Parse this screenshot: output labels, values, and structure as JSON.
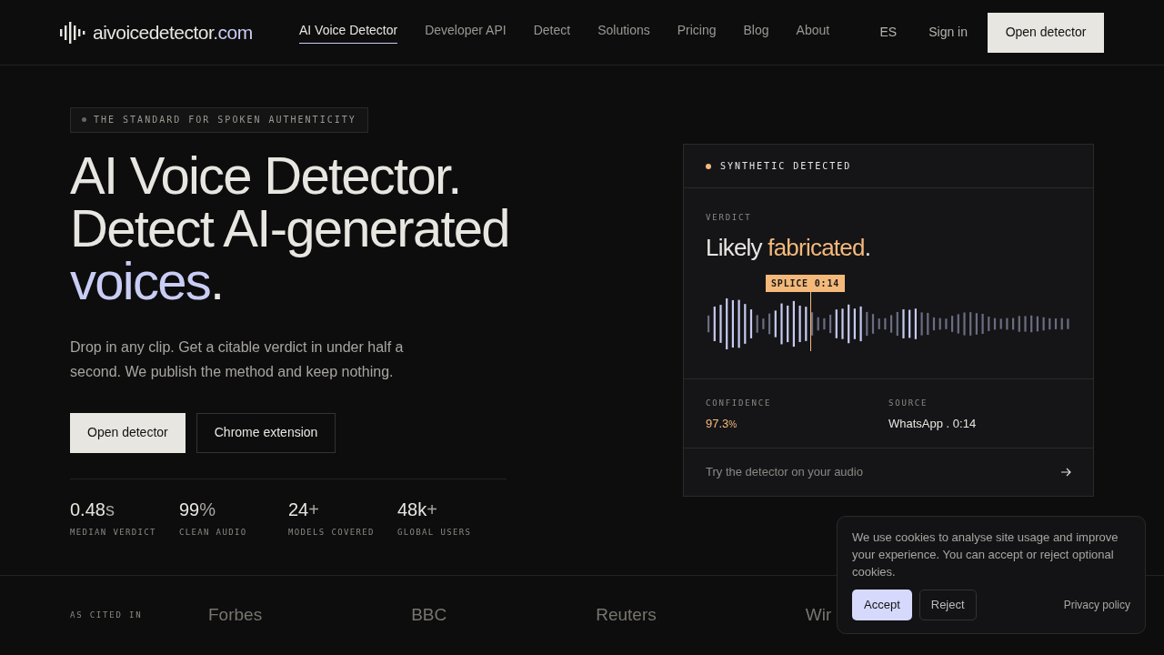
{
  "header": {
    "logo": {
      "name": "aivoicedetector",
      "tld": ".com"
    },
    "nav": [
      {
        "label": "AI Voice Detector",
        "selected": true
      },
      {
        "label": "Developer API",
        "selected": false
      },
      {
        "label": "Detect",
        "selected": false
      },
      {
        "label": "Solutions",
        "selected": false
      },
      {
        "label": "Pricing",
        "selected": false
      },
      {
        "label": "Blog",
        "selected": false
      },
      {
        "label": "About",
        "selected": false
      }
    ],
    "language": "ES",
    "sign_in": "Sign in",
    "cta": "Open detector"
  },
  "hero": {
    "eyebrow": "THE STANDARD FOR SPOKEN AUTHENTICITY",
    "title": [
      [
        {
          "text": "AI Voice Detector.",
          "accent": false
        }
      ],
      [
        {
          "text": "Detect AI-generated",
          "accent": false
        }
      ],
      [
        {
          "text": "voices",
          "accent": true
        },
        {
          "text": ".",
          "accent": false
        }
      ]
    ],
    "description": "Drop in any clip. Get a citable verdict in under half a second. We publish the method and keep nothing.",
    "buttons": [
      {
        "label": "Open detector",
        "kind": "primary"
      },
      {
        "label": "Chrome extension",
        "kind": "secondary"
      }
    ],
    "stats": [
      {
        "value": "0.48",
        "unit": "s",
        "label": "MEDIAN VERDICT"
      },
      {
        "value": "99",
        "unit": "%",
        "label": "CLEAN AUDIO"
      },
      {
        "value": "24",
        "unit": "+",
        "label": "MODELS COVERED"
      },
      {
        "value": "48k",
        "unit": "+",
        "label": "GLOBAL USERS"
      }
    ]
  },
  "verdict_card": {
    "status": "SYNTHETIC DETECTED",
    "verdict_label": "VERDICT",
    "verdict": [
      {
        "text": "Likely ",
        "accent": false
      },
      {
        "text": "fabricated",
        "accent": true
      },
      {
        "text": ".",
        "accent": false
      }
    ],
    "splice_label": "SPLICE 0:14",
    "confidence_label": "CONFIDENCE",
    "confidence_value": "97.3",
    "confidence_unit": "%",
    "source_label": "SOURCE",
    "source_value": "WhatsApp . 0:14",
    "footer_link": "Try the detector on your audio"
  },
  "cited": {
    "label": "AS CITED IN",
    "outlets": [
      "Forbes",
      "BBC",
      "Reuters",
      "Wir"
    ]
  },
  "cookie_banner": {
    "message": "We use cookies to analyse site usage and improve your experience. You can accept or reject optional cookies.",
    "accept": "Accept",
    "reject": "Reject",
    "privacy_link": "Privacy policy"
  }
}
